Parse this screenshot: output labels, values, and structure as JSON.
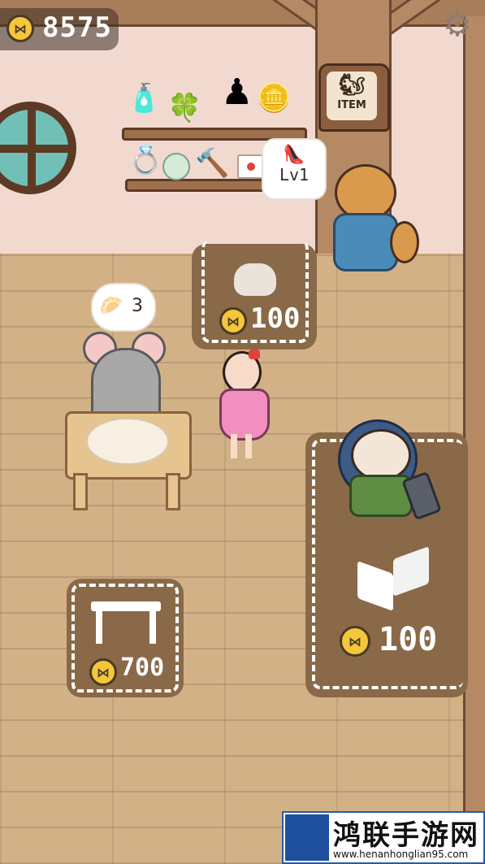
{
  "hud": {
    "coins": "8575",
    "coin_icon": "coin-icon",
    "settings_icon": "gear-icon"
  },
  "shop_sign": {
    "label": "ITEM",
    "icon": "sign-icon"
  },
  "shelf_items": [
    "perfume-icon",
    "clover-icon",
    "chess-pawn-icon",
    "gold-coin-icon",
    "ring-icon",
    "pearl-icon",
    "hammer-icon",
    "card-icon"
  ],
  "shopkeeper_bubble": {
    "label": "Lv1",
    "icon": "red-shoe-icon"
  },
  "customer_bubble": {
    "count": "3",
    "icon": "dumpling-icon"
  },
  "tiles": {
    "bun_price": "100",
    "table_price": "700",
    "room_price": "100"
  },
  "watermark": {
    "title": "鸿联手游网",
    "url": "www.henanhonglian95.com"
  }
}
